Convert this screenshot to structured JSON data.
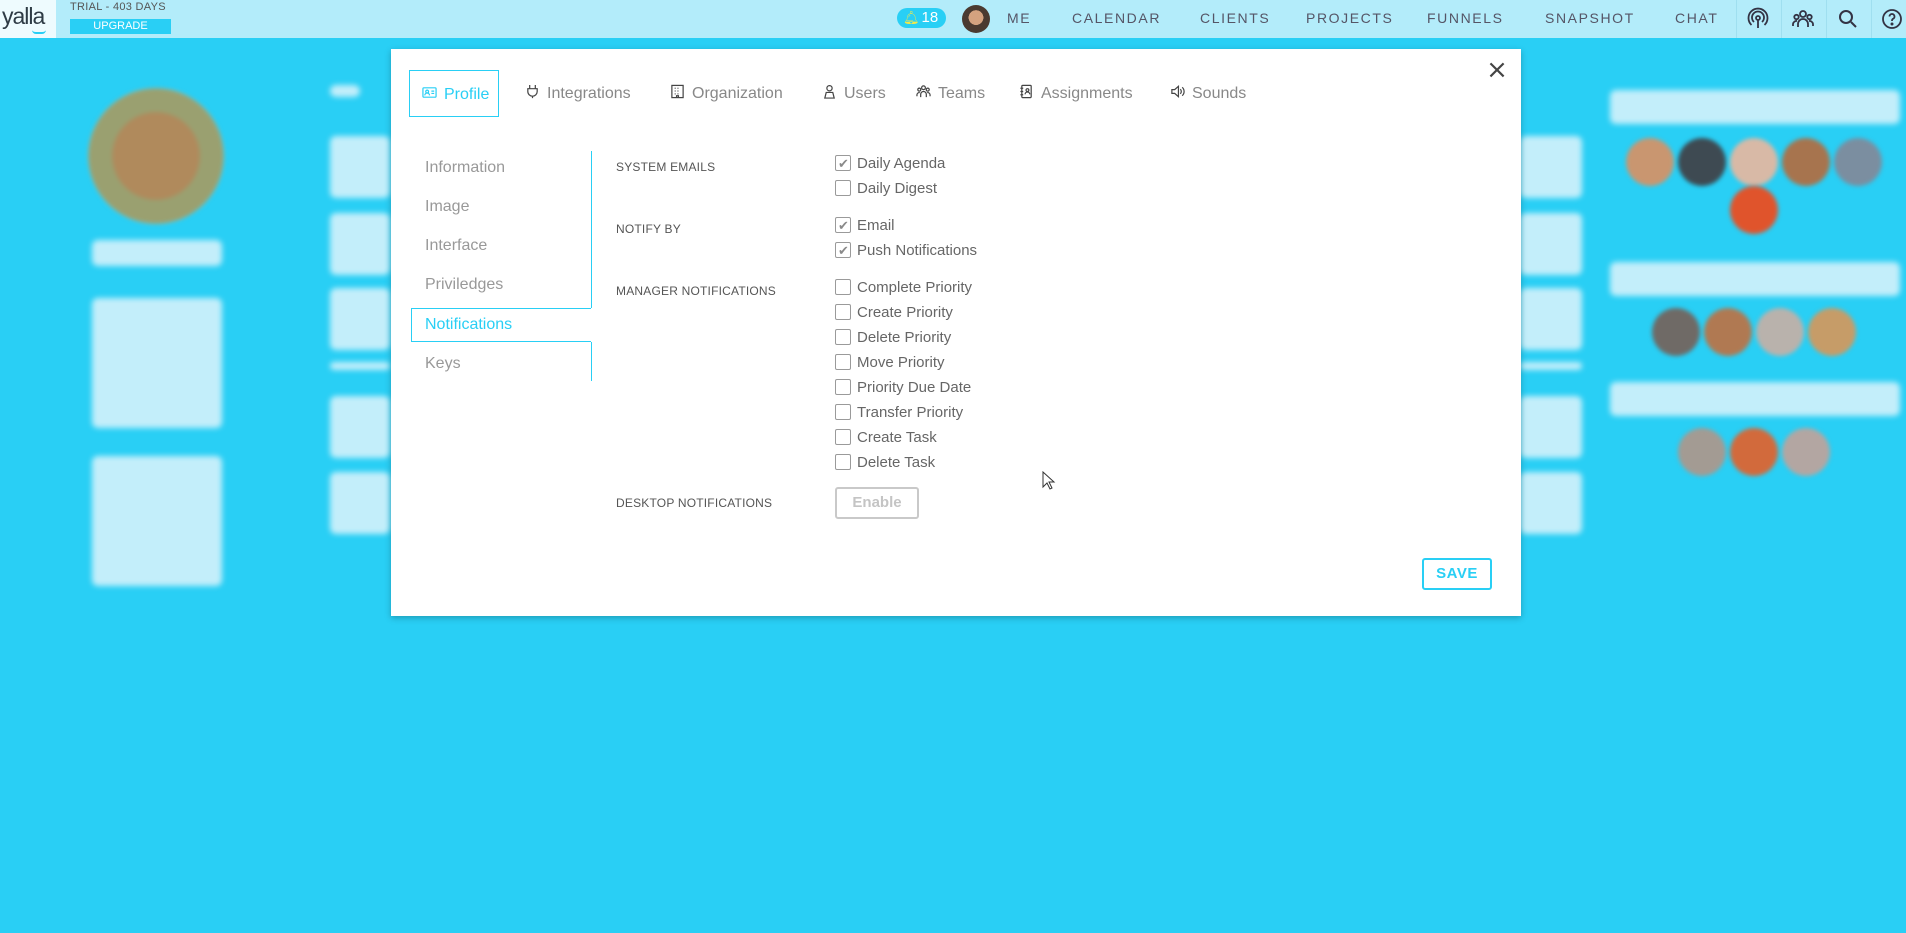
{
  "topbar": {
    "logo": "yalla",
    "trial_text": "TRIAL - 403 DAYS",
    "upgrade_label": "UPGRADE",
    "notification_count": "18",
    "nav": [
      "ME",
      "CALENDAR",
      "CLIENTS",
      "PROJECTS",
      "FUNNELS",
      "SNAPSHOT",
      "CHAT"
    ],
    "icons": [
      "broadcast-icon",
      "team-icon",
      "search-icon",
      "help-icon"
    ]
  },
  "modal": {
    "tabs": [
      {
        "label": "Profile",
        "icon": "id-card-icon",
        "active": true
      },
      {
        "label": "Integrations",
        "icon": "plug-icon"
      },
      {
        "label": "Organization",
        "icon": "building-icon"
      },
      {
        "label": "Users",
        "icon": "user-icon"
      },
      {
        "label": "Teams",
        "icon": "teams-icon"
      },
      {
        "label": "Assignments",
        "icon": "contacts-book-icon"
      },
      {
        "label": "Sounds",
        "icon": "speaker-icon"
      }
    ],
    "side": [
      "Information",
      "Image",
      "Interface",
      "Priviledges",
      "Notifications",
      "Keys"
    ],
    "side_active": "Notifications",
    "sections": {
      "system_emails": {
        "label": "SYSTEM EMAILS",
        "items": [
          {
            "label": "Daily Agenda",
            "checked": true
          },
          {
            "label": "Daily Digest",
            "checked": false
          }
        ]
      },
      "notify_by": {
        "label": "NOTIFY BY",
        "items": [
          {
            "label": "Email",
            "checked": true
          },
          {
            "label": "Push Notifications",
            "checked": true
          }
        ]
      },
      "manager": {
        "label": "MANAGER NOTIFICATIONS",
        "items": [
          {
            "label": "Complete Priority",
            "checked": false
          },
          {
            "label": "Create Priority",
            "checked": false
          },
          {
            "label": "Delete Priority",
            "checked": false
          },
          {
            "label": "Move Priority",
            "checked": false
          },
          {
            "label": "Priority Due Date",
            "checked": false
          },
          {
            "label": "Transfer Priority",
            "checked": false
          },
          {
            "label": "Create Task",
            "checked": false
          },
          {
            "label": "Delete Task",
            "checked": false
          }
        ]
      },
      "desktop": {
        "label": "DESKTOP NOTIFICATIONS",
        "button_label": "Enable"
      }
    },
    "save_label": "SAVE",
    "colors": {
      "accent": "#29cff5",
      "topbar": "#b3ecfa"
    }
  }
}
